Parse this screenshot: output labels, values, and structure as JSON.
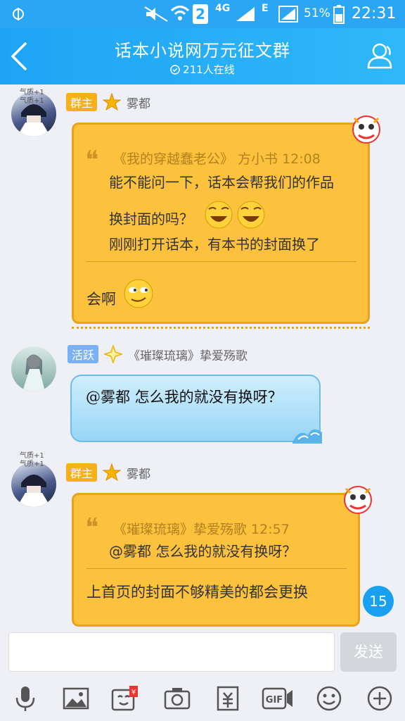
{
  "status": {
    "network_label": "4G",
    "signal_e": "E",
    "sim_number": "2",
    "battery": "51%",
    "time": "22:31"
  },
  "header": {
    "title": "话本小说网万元征文群",
    "online": "211人在线"
  },
  "messages": [
    {
      "badge": "群主",
      "sender": "雾都",
      "quote_head": "《我的穿越蠢老公》 方小书 12:08",
      "quote_lines": [
        "能不能问一下，话本会帮我们的作品",
        "换封面的吗？",
        "刚刚打开话本，有本书的封面换了"
      ],
      "reply": "会啊"
    },
    {
      "badge": "活跃",
      "sender": "《璀璨琉璃》挚爱殇歌",
      "text": "@雾都 怎么我的就没有换呀？"
    },
    {
      "badge": "群主",
      "sender": "雾都",
      "quote_head": "《璀璨琉璃》挚爱殇歌 12:57",
      "quote_lines": [
        "@雾都 怎么我的就没有换呀？"
      ],
      "reply": "上首页的封面不够精美的都会更换"
    }
  ],
  "avatar_tags": [
    "气质+1",
    "气质+1",
    "气质+1",
    "气质+1"
  ],
  "unread_count": "15",
  "input": {
    "placeholder": "",
    "send_label": "发送"
  },
  "toolbar_icons": [
    "microphone-icon",
    "image-icon",
    "red-packet-icon",
    "camera-icon",
    "transfer-icon",
    "gif-icon",
    "emoji-icon",
    "plus-icon"
  ],
  "colors": {
    "brand": "#2aa6f5",
    "bubble_yellow": "#fcc23d",
    "bubble_blue": "#98d6f7"
  }
}
